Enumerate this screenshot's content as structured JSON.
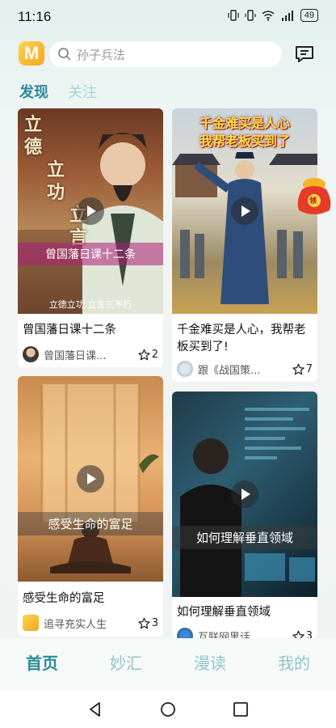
{
  "status": {
    "time": "11:16",
    "battery": "49"
  },
  "search": {
    "placeholder": "孙子兵法"
  },
  "tabs": [
    {
      "label": "发现"
    },
    {
      "label": "关注"
    }
  ],
  "cards": [
    {
      "title": "曾国藩日课十二条",
      "author": "曾国藩日课...",
      "likes": "2",
      "overlay_text": "曾国藩日课十二条",
      "caption": "立德立功 立言三不朽",
      "art_text": [
        "立",
        "德",
        "立",
        "功",
        "立",
        "言"
      ]
    },
    {
      "title": "千金难买是人心，我帮老板买到了!",
      "author": "跟《战国策...",
      "likes": "7",
      "art_text": [
        "千金难买是人心",
        "我帮老板买到了"
      ]
    },
    {
      "title": "感受生命的富足",
      "author": "追寻充实人生",
      "likes": "3",
      "overlay_text": "感受生命的富足"
    },
    {
      "title": "如何理解垂直领域",
      "author": "互联网黑话",
      "likes": "3",
      "overlay_text": "如何理解垂直领域"
    }
  ],
  "promo": {
    "badge": "领"
  },
  "bottom_nav": [
    {
      "label": "首页",
      "active": true
    },
    {
      "label": "妙汇"
    },
    {
      "label": "漫读"
    },
    {
      "label": "我的"
    }
  ],
  "colors": {
    "accent": "#2b8a99",
    "inactive": "#a7d4d8"
  }
}
